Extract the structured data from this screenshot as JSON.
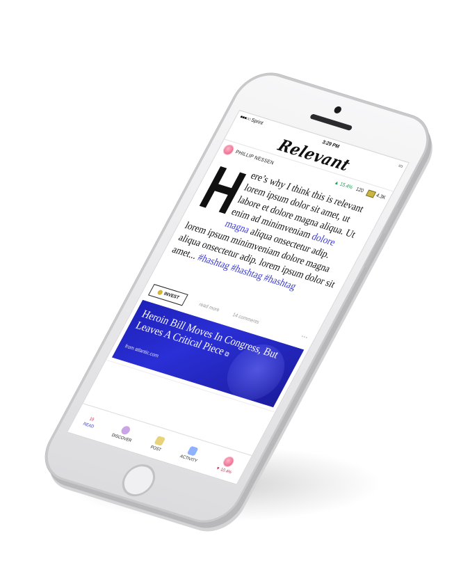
{
  "status_bar": {
    "signal_dots": "●●●○○",
    "carrier": "Sprint",
    "time": "3:29 PM",
    "battery": "▭"
  },
  "header": {
    "logo": "Relevant"
  },
  "post": {
    "author": "PHILLIP NESSEN",
    "percent_change": "▲ 15.4%",
    "relevance_count": "120",
    "cash_value": "4.3K",
    "dropcap": "H",
    "text_before_link": "ere’s why I think this is relevant lorem ipsum dolor sit amet, ut labore et dolore magna aliqua. Ut enim ad minimveniam ",
    "link_text": "dolore magna",
    "text_after_link": " aliqua onsectetur adip. lorem ipsum minimveniam dolore magna aliqua onsectetur adip. lorem ipsum dolor sit amet... ",
    "hashtags": "#hashtag #hashtag #hashtag",
    "invest_label": "INVEST",
    "read_more": "read more",
    "comments": "14 comments",
    "more_menu": "···"
  },
  "link_card": {
    "title": "Heroin Bill Moves In Congress, But Leaves A Critical Piece",
    "source": "from atlantic.com",
    "external_icon": "⧉"
  },
  "tabbar": {
    "read": {
      "label": "READ",
      "badge": "19"
    },
    "discover": {
      "label": "DISCOVER"
    },
    "post": {
      "label": "POST"
    },
    "activity": {
      "label": "ACTIVITY"
    },
    "profile": {
      "change": "▼ 10.4%"
    }
  },
  "colors": {
    "accent_blue": "#3b3bd1",
    "card_blue": "#1e21b8",
    "positive_green": "#1d9a4d",
    "negative_red": "#c0304f"
  }
}
